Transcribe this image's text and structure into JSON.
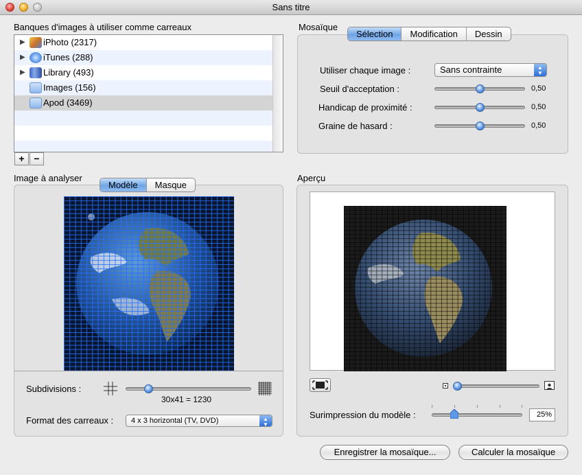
{
  "window": {
    "title": "Sans titre"
  },
  "image_banks": {
    "label": "Banques d'images à utiliser comme carreaux",
    "items": [
      {
        "label": "iPhoto (2317)",
        "icon": "iphoto-icon",
        "expandable": true
      },
      {
        "label": "iTunes (288)",
        "icon": "itunes-icon",
        "expandable": true
      },
      {
        "label": "Library (493)",
        "icon": "library-icon",
        "expandable": true
      },
      {
        "label": "Images (156)",
        "icon": "folder-icon",
        "expandable": false
      },
      {
        "label": "Apod (3469)",
        "icon": "folder-icon",
        "expandable": false,
        "selected": true
      }
    ],
    "add": "+",
    "remove": "−"
  },
  "mosaic": {
    "label": "Mosaïque",
    "tabs": [
      "Sélection",
      "Modification",
      "Dessin"
    ],
    "active_tab": "Sélection",
    "use_each_image": {
      "label": "Utiliser chaque image :",
      "value": "Sans contrainte"
    },
    "sliders": [
      {
        "label": "Seuil d'acceptation :",
        "value": "0,50",
        "level": 0.5
      },
      {
        "label": "Handicap de proximité :",
        "value": "0,50",
        "level": 0.5
      },
      {
        "label": "Graine de hasard :",
        "value": "0,50",
        "level": 0.5
      }
    ]
  },
  "analyze": {
    "label": "Image à analyser",
    "tabs": [
      "Modèle",
      "Masque"
    ],
    "active_tab": "Modèle",
    "subdivisions_label": "Subdivisions :",
    "subdivisions_value": "30x41 = 1230",
    "subdivisions_level": 0.18,
    "tile_format_label": "Format des carreaux :",
    "tile_format_value": "4 x 3 horizontal (TV, DVD)"
  },
  "preview": {
    "label": "Aperçu",
    "zoom_level": 0.05,
    "overprint_label": "Surimpression du modèle :",
    "overprint_value": "25%",
    "overprint_level": 0.25
  },
  "buttons": {
    "save": "Enregistrer la mosaïque...",
    "compute": "Calculer la mosaïque"
  },
  "colors": {
    "accent": "#5e98e4",
    "selection_row": "#d4d4d4",
    "alt_row": "#edf3fe"
  }
}
